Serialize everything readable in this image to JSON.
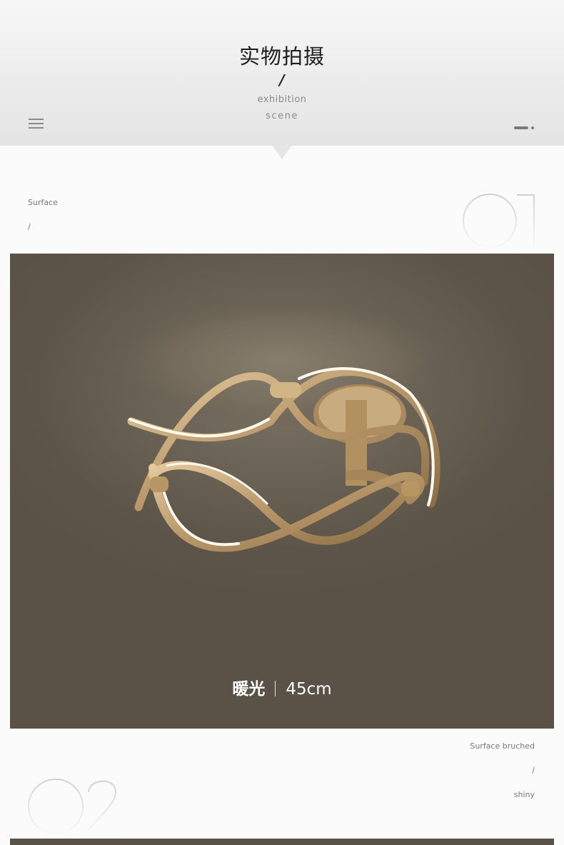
{
  "header": {
    "title": "实物拍摄",
    "slash": "/",
    "subtitle_line1": "exhibition",
    "subtitle_line2": "scene"
  },
  "section1": {
    "label": "Surface",
    "slash": "/",
    "number": "01",
    "caption_cn": "暖光",
    "caption_size": "45cm"
  },
  "section2": {
    "label_line1": "Surface bruched",
    "slash": "/",
    "label_line2": "shiny",
    "number": "02"
  },
  "icons": {
    "menu": "menu-icon",
    "pager": "pager-dots-icon"
  },
  "colors": {
    "photo_background": "#5d5549",
    "lamp_gold": "#c4a67a",
    "led_glow": "#fff8ec"
  }
}
